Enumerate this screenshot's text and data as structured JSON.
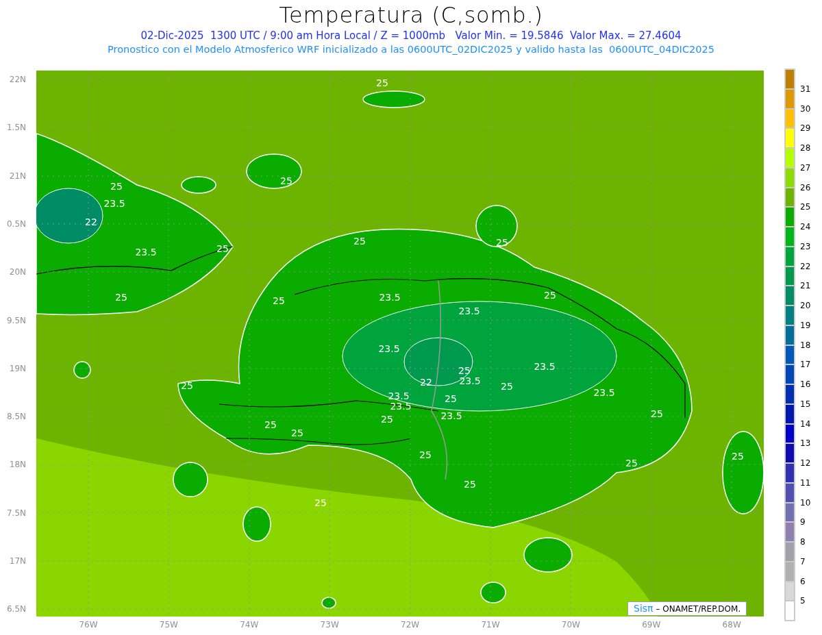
{
  "title": "Temperatura (C,somb.)",
  "subtitle": "02-Dic-2025  1300 UTC / 9:00 am Hora Local / Z = 1000mb   Valor Min. = 19.5846  Valor Max. = 27.4604",
  "description": "Pronostico con el Modelo Atmosferico WRF inicializado a las 0600UTC_02DIC2025 y valido hasta las  0600UTC_04DIC2025",
  "lat_labels": [
    "22N",
    "1.5N",
    "21N",
    "0.5N",
    "20N",
    "9.5N",
    "19N",
    "8.5N",
    "18N",
    "7.5N",
    "17N",
    "6.5N"
  ],
  "lon_labels": [
    "76W",
    "75W",
    "74W",
    "73W",
    "72W",
    "71W",
    "70W",
    "69W",
    "68W"
  ],
  "contour_labels": [
    "25",
    "25",
    "25",
    "23.5",
    "22",
    "25",
    "25",
    "23.5",
    "25",
    "25",
    "25",
    "23.5",
    "25",
    "23.5",
    "23.5",
    "25",
    "22",
    "25",
    "23.5",
    "23.5",
    "25",
    "23.5",
    "23.5",
    "25",
    "23.5",
    "25",
    "23.5",
    "25",
    "25",
    "25",
    "25",
    "25",
    "25",
    "25",
    "25"
  ],
  "colorbar": {
    "labels": [
      "31",
      "30",
      "29",
      "28",
      "27",
      "26",
      "25",
      "24",
      "23",
      "22",
      "21",
      "20",
      "19",
      "18",
      "17",
      "16",
      "15",
      "14",
      "13",
      "12",
      "11",
      "10",
      "9",
      "8",
      "7",
      "6",
      "5"
    ],
    "boxes": [
      {
        "color": "#bf7f00"
      },
      {
        "color": "#e09800"
      },
      {
        "color": "#ffc000"
      },
      {
        "color": "#ffff00"
      },
      {
        "color": "#b4ff00"
      },
      {
        "color": "#8cdc00"
      },
      {
        "color": "#6cb400"
      },
      {
        "color": "#0aac00"
      },
      {
        "color": "#00b41c"
      },
      {
        "color": "#00a43c"
      },
      {
        "color": "#009a4e"
      },
      {
        "color": "#008c64"
      },
      {
        "color": "#008082"
      },
      {
        "color": "#00709a"
      },
      {
        "color": "#0058b8"
      },
      {
        "color": "#0046b8"
      },
      {
        "color": "#0030b0"
      },
      {
        "color": "#0018b0"
      },
      {
        "color": "#0000c8"
      },
      {
        "color": "#1008b0"
      },
      {
        "color": "#3030b0"
      },
      {
        "color": "#5050b0"
      },
      {
        "color": "#7070b0"
      },
      {
        "color": "#9080b0"
      },
      {
        "color": "#a0a0a8"
      },
      {
        "color": "#b0b0b0"
      },
      {
        "color": "#d8d8d8"
      },
      {
        "color": "#ffffff"
      }
    ]
  },
  "credit": {
    "logo": "Sisπ",
    "text": "– ONAMET/REP.DOM."
  }
}
